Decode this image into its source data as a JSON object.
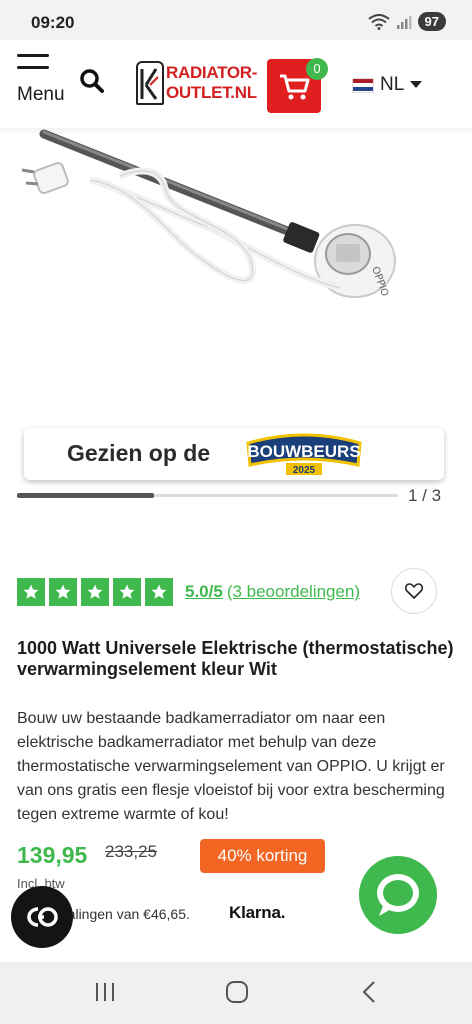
{
  "status_bar": {
    "time": "09:20",
    "battery": "97"
  },
  "header": {
    "menu_label": "Menu",
    "logo_line1": "RADIATOR-",
    "logo_line2": "OUTLET.NL",
    "cart_count": "0",
    "language": "NL"
  },
  "gallery": {
    "banner_text": "Gezien op de",
    "banner_logo_name": "BOUWBEURS",
    "banner_logo_year": "2025",
    "counter": "1 / 3",
    "progress": 0.36
  },
  "product": {
    "rating_stars": 5,
    "rating_score": "5.0/5",
    "rating_reviews": "(3 beoordelingen)",
    "title": "1000 Watt Universele Elektrische (thermostatische) verwarmingselement kleur Wit",
    "description": "Bouw uw bestaande badkamerradiator om naar een elektrische badkamerradiator met behulp van deze thermostatische verwarmingselement van OPPIO. U krijgt er van ons gratis een flesje vloeistof bij voor extra bescherming tegen extreme warmte of kou!",
    "price": "139,95",
    "old_price": "233,25",
    "discount": "40% korting",
    "price_note": "Incl. btw",
    "klarna_text": "etalingen van €46,65.",
    "klarna_logo": "Klarna."
  },
  "floating": {
    "co_label": "CO"
  },
  "colors": {
    "brand_red": "#e02020",
    "accent_green": "#3fb94d",
    "discount_orange": "#f26522"
  },
  "icons": [
    "hamburger-icon",
    "search-icon",
    "cart-icon",
    "chevron-down-icon",
    "star-icon",
    "heart-icon",
    "chat-icon",
    "recent-apps-icon",
    "home-icon",
    "back-icon"
  ]
}
